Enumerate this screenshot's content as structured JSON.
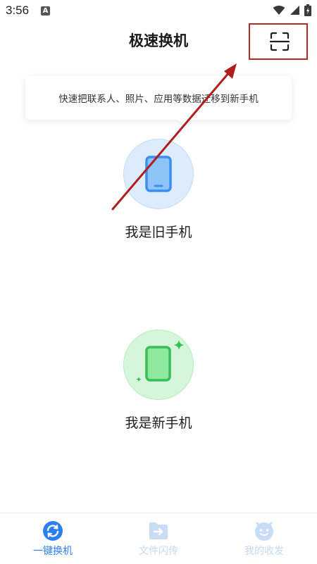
{
  "status_bar": {
    "time": "3:56",
    "icons": [
      "a-notification-icon",
      "wifi-icon",
      "signal-icon",
      "battery-charging-icon"
    ]
  },
  "header": {
    "title": "极速换机",
    "scan_icon": "scan-icon"
  },
  "tip": {
    "text": "快速把联系人、照片、应用等数据迁移到新手机"
  },
  "roles": {
    "old_phone": {
      "label": "我是旧手机",
      "icon": "phone-icon"
    },
    "new_phone": {
      "label": "我是新手机",
      "icon": "phone-sparkle-icon"
    }
  },
  "bottom_nav": {
    "items": [
      {
        "label": "一键换机",
        "icon": "sync-icon",
        "active": true
      },
      {
        "label": "文件闪传",
        "icon": "file-transfer-icon",
        "active": false
      },
      {
        "label": "我的收发",
        "icon": "smiley-icon",
        "active": false
      }
    ]
  },
  "colors": {
    "accent": "#2d7ff0",
    "old_circle": "#dcecfd",
    "new_circle": "#d5f6da",
    "highlight_border": "#b02a2a",
    "annotation_arrow": "#b01e1e"
  }
}
